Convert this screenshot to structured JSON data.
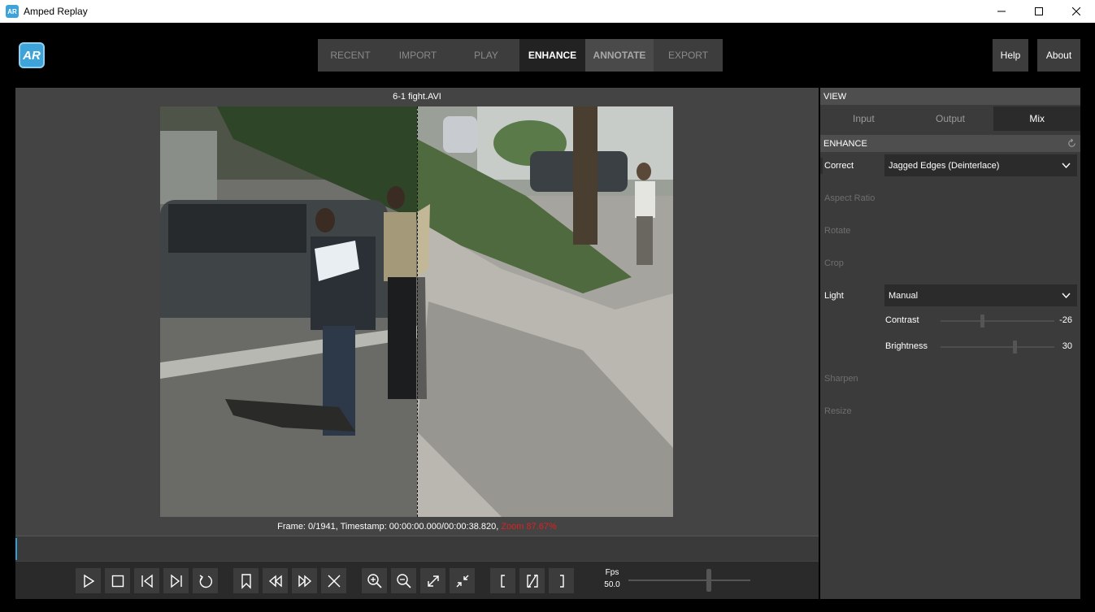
{
  "window": {
    "title": "Amped Replay",
    "minimize": "—",
    "maximize": "☐",
    "close": "✕"
  },
  "logo": {
    "text": "AR"
  },
  "nav": {
    "tabs": [
      "RECENT",
      "IMPORT",
      "PLAY",
      "ENHANCE",
      "ANNOTATE",
      "EXPORT"
    ],
    "active": "ENHANCE"
  },
  "header": {
    "help": "Help",
    "about": "About"
  },
  "viewer": {
    "file_name": "6-1 fight.AVI",
    "frame_info": "Frame: 0/1941, Timestamp: 00:00:00.000/00:00:38.820,",
    "zoom_info": "Zoom 87.67%"
  },
  "playback": {
    "fps_label": "Fps",
    "fps_value": "50.0",
    "fps_slider_level": 0.66,
    "buttons": [
      "play",
      "stop",
      "previous-frame",
      "next-frame",
      "loop",
      "bookmark",
      "rewind",
      "fast-forward",
      "clear",
      "zoom-in",
      "zoom-out",
      "fit-to-window",
      "actual-size",
      "mark-in",
      "clear-marks",
      "mark-out"
    ]
  },
  "panel": {
    "view_header": "VIEW",
    "view_tabs": [
      "Input",
      "Output",
      "Mix"
    ],
    "view_active": "Mix",
    "enhance_header": "ENHANCE",
    "correct_label": "Correct",
    "correct_value": "Jagged Edges (Deinterlace)",
    "aspect_ratio_label": "Aspect Ratio",
    "rotate_label": "Rotate",
    "crop_label": "Crop",
    "light_label": "Light",
    "light_value": "Manual",
    "contrast_label": "Contrast",
    "contrast_value": "-26",
    "brightness_label": "Brightness",
    "brightness_value": "30",
    "sharpen_label": "Sharpen",
    "resize_label": "Resize"
  },
  "colors": {
    "accent": "#3ea3d8",
    "zoom_text": "#e02020",
    "panel_bg": "#3b3b3b",
    "viewer_bg": "#444444"
  }
}
